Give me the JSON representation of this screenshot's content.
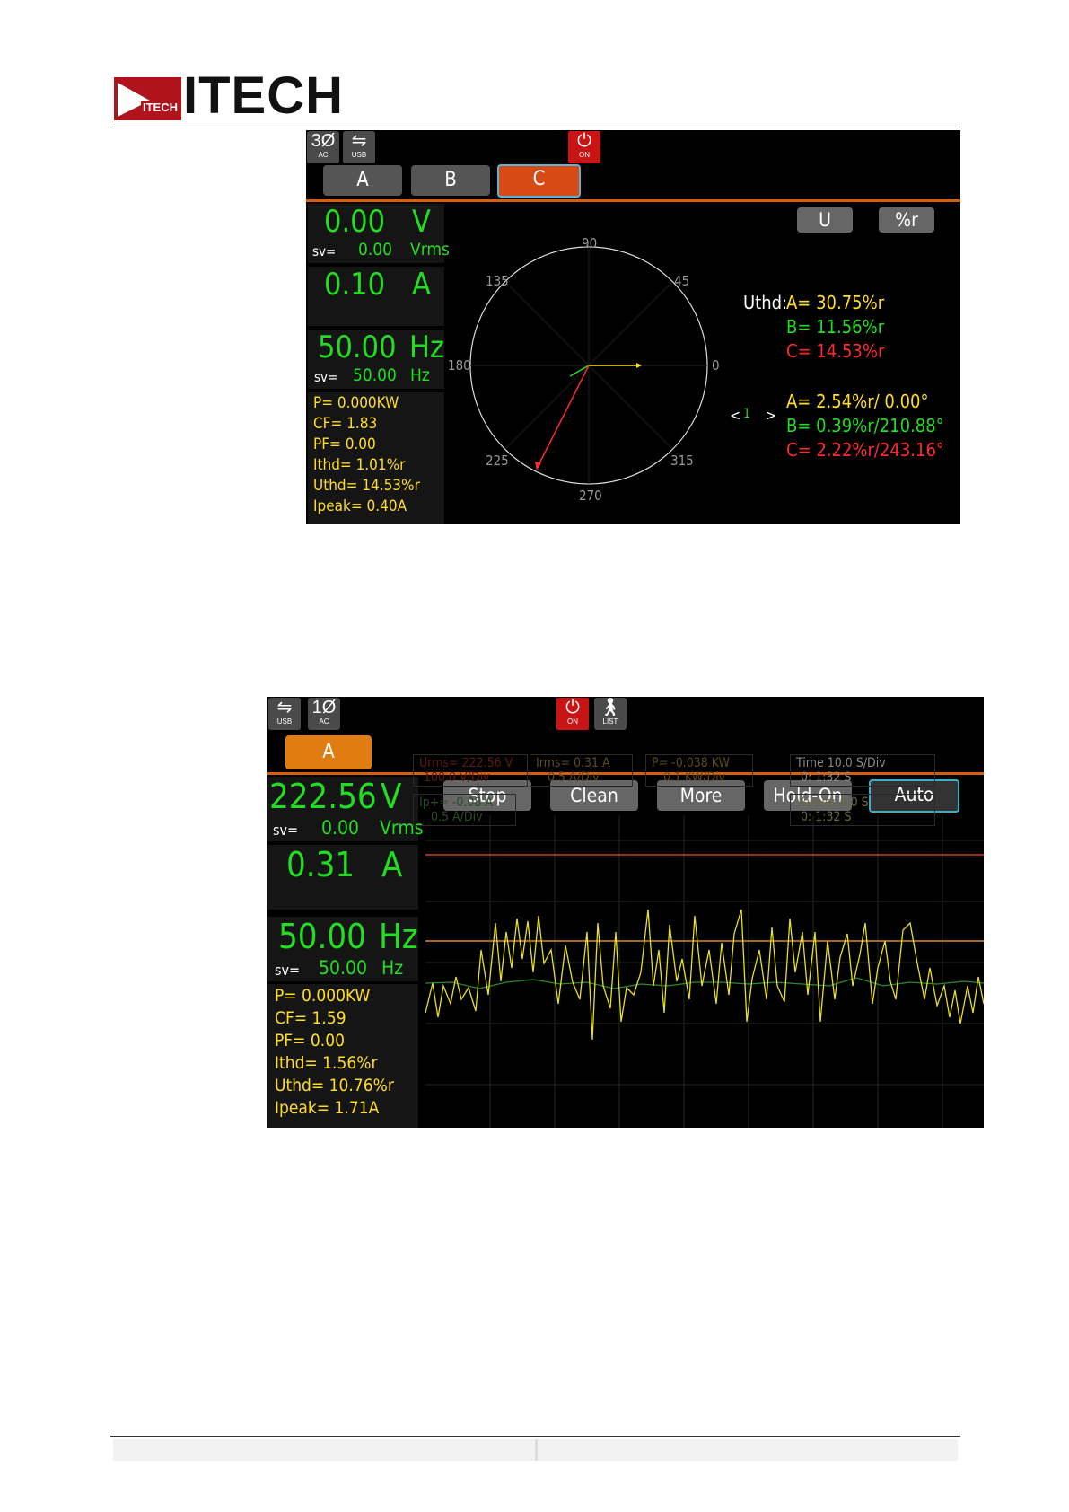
{
  "brand": {
    "name": "ITECH",
    "mark_text": "ITECH"
  },
  "screen1": {
    "icons": {
      "phase": "3Ø",
      "phase_sub": "AC",
      "usb_sub": "USB",
      "power_sub": "ON"
    },
    "tabs": [
      "A",
      "B",
      "C"
    ],
    "voltage": {
      "value": "0.00",
      "unit": "V",
      "sv_label": "sv=",
      "sv_value": "0.00",
      "sv_unit": "Vrms"
    },
    "current": {
      "value": "0.10",
      "unit": "A"
    },
    "freq": {
      "value": "50.00",
      "unit": "Hz",
      "sv_label": "sv=",
      "sv_value": "50.00",
      "sv_unit": "Hz"
    },
    "stats": [
      "P= 0.000KW",
      "CF=  1.83",
      "PF=  0.00",
      "Ithd=  1.01%r",
      "Uthd= 14.53%r",
      "Ipeak=  0.40A"
    ],
    "buttons": {
      "u": "U",
      "pct": "%r"
    },
    "polar": {
      "labels": [
        "90",
        "45",
        "0",
        "315",
        "270",
        "225",
        "180",
        "135"
      ]
    },
    "uthd": {
      "label": "Uthd:",
      "a": "A=  30.75%r",
      "b": "B=  11.56%r",
      "c": "C=  14.53%r"
    },
    "harm": {
      "nav_prev": "<",
      "nav_index": "1",
      "nav_next": ">",
      "a": "A=   2.54%r/  0.00°",
      "b": "B=   0.39%r/210.88°",
      "c": "C=   2.22%r/243.16°"
    },
    "colors": {
      "a": "#ffdd22",
      "b": "#22dd22",
      "c": "#ff2a2a"
    }
  },
  "screen2": {
    "icons": {
      "usb_sub": "USB",
      "phase": "1Ø",
      "phase_sub": "AC",
      "power_sub": "ON",
      "list_sub": "LIST"
    },
    "tab": "A",
    "voltage": {
      "value": "222.56",
      "unit": "V",
      "sv_label": "sv=",
      "sv_value": "0.00",
      "sv_unit": "Vrms"
    },
    "current": {
      "value": "0.31",
      "unit": "A"
    },
    "freq": {
      "value": "50.00",
      "unit": "Hz",
      "sv_label": "sv=",
      "sv_value": "50.00",
      "sv_unit": "Hz"
    },
    "stats": [
      "P= 0.000KW",
      "CF=  1.59",
      "PF=  0.00",
      "Ithd=  1.56%r",
      "Uthd= 10.76%r",
      "Ipeak=  1.71A"
    ],
    "buttons": [
      "Stop",
      "Clean",
      "More",
      "Hold-On",
      "Auto"
    ],
    "info": {
      "urms": "Urms= 222.56 V",
      "urms_div": "100.0 V/Div",
      "irms": "Irms=  0.31 A",
      "irms_div": "0.5 A/Div",
      "p": "P= -0.038 KW",
      "p_div": "0.1 KW/Div",
      "time": "Time  10.0 S/Div",
      "time_sub": "0: 1:32 S",
      "ip": "Ip+= -0.08 A",
      "ip_div": "0.5 A/Div",
      "vernier": "Vernier     0.0 S",
      "vernier_sub": "0: 1:32 S"
    }
  }
}
